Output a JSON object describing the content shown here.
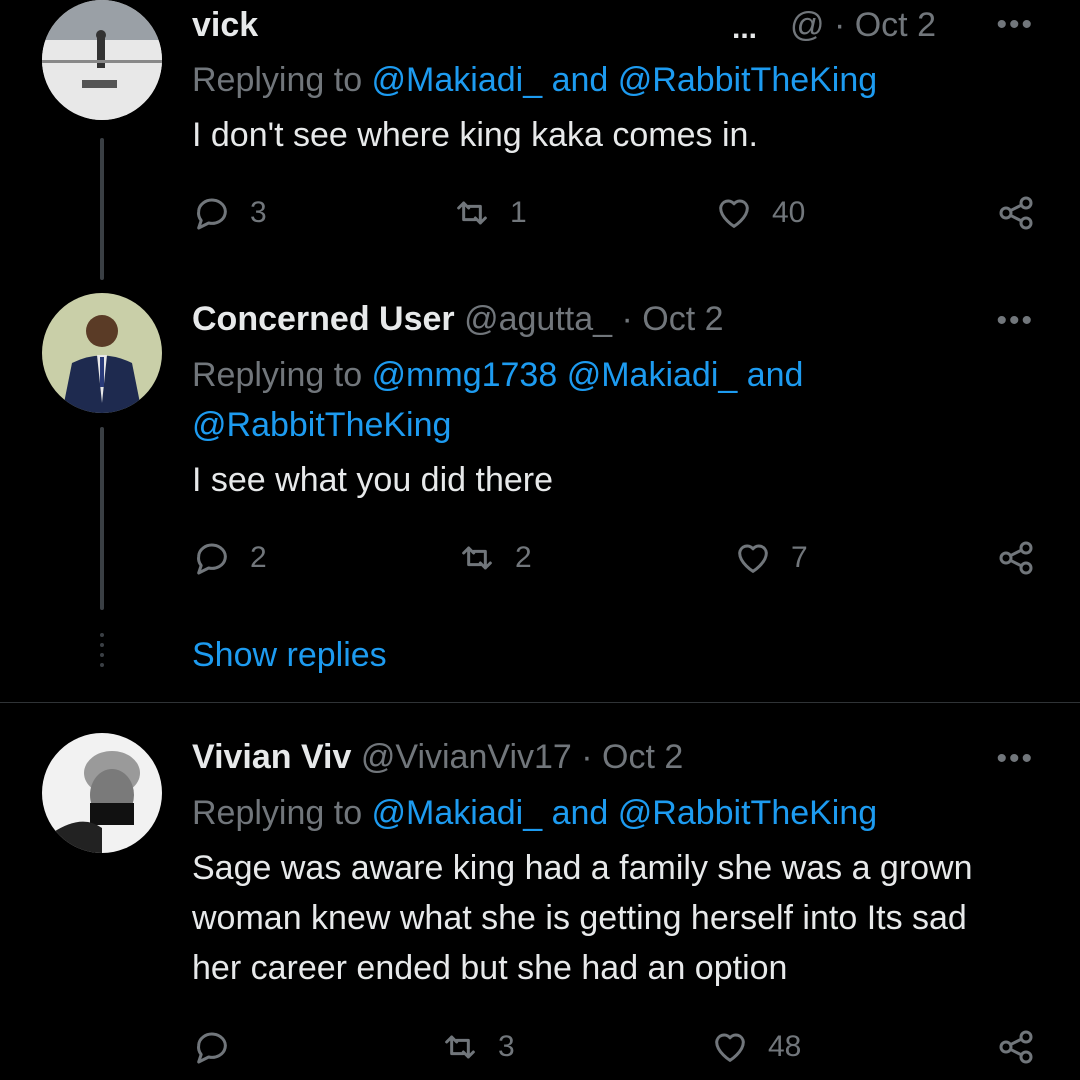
{
  "tweets": [
    {
      "name": "vick",
      "handle": "@",
      "ellipsis": "...",
      "date": "· Oct 2",
      "reply_prefix": "Replying to ",
      "reply_mentions_1": "@Makiadi_ and @RabbitTheKing",
      "text": "I don't see where king kaka comes in.",
      "replies": "3",
      "retweets": "1",
      "likes": "40"
    },
    {
      "name": "Concerned User",
      "handle": "@agutta_",
      "date": "· Oct 2",
      "reply_prefix": "Replying to ",
      "reply_mentions_1": "@mmg1738 @Makiadi_ and",
      "reply_mentions_2": "@RabbitTheKing",
      "text": "I see what you did there",
      "replies": "2",
      "retweets": "2",
      "likes": "7"
    },
    {
      "name": "Vivian Viv",
      "handle": "@VivianViv17",
      "date": "· Oct 2",
      "reply_prefix": "Replying to ",
      "reply_mentions_1": "@Makiadi_ and @RabbitTheKing",
      "text_lines": [
        "Sage was aware king had a family she was a grown",
        "woman knew what she is getting herself into Its sad",
        "her career ended but she had an option"
      ],
      "replies": "",
      "retweets": "3",
      "likes": "48"
    }
  ],
  "show_replies": "Show replies",
  "more_icon": "•••",
  "colors": {
    "background": "#000000",
    "link": "#1d9bf0",
    "muted": "#71767b",
    "text": "#e7e9ea"
  }
}
